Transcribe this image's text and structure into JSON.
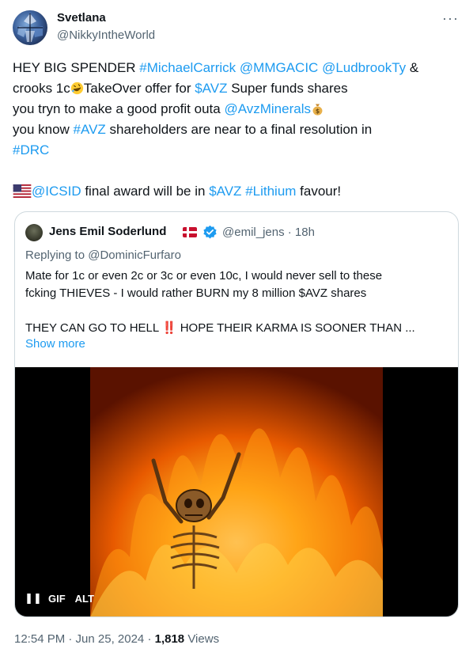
{
  "author": {
    "name": "Svetlana",
    "handle": "@NikkyIntheWorld",
    "avatar_icon": "stained-glass-avatar"
  },
  "more_label": "···",
  "tweet": {
    "l1_text1": "HEY BIG SPENDER ",
    "l1_link1": "#MichaelCarrick",
    "l1_link2": "@MMGACIC",
    "l1_link3": "@LudbrookTy",
    "l1_text2": " &",
    "l2_text1": "crooks 1c",
    "l2_emoji": "rolling-on-floor-laughing-emoji",
    "l2_text2": "TakeOver offer for ",
    "l2_link1": "$AVZ",
    "l2_text3": " Super funds shares",
    "l3_text1": "you tryn to make a good profit outa ",
    "l3_link1": "@AvzMinerals",
    "l3_emoji": "money-bag-emoji",
    "l4_text1": "you know ",
    "l4_link1": "#AVZ",
    "l4_text2": " shareholders are near to a final resolution in",
    "l5_link1": "#DRC",
    "l6_emoji": "us-flag-emoji",
    "l6_link1": "@ICSID",
    "l6_text1": " final award will be in ",
    "l6_link2": "$AVZ",
    "l6_link3": "#Lithium",
    "l6_text2": " favour!"
  },
  "quote": {
    "name": "Jens Emil Soderlund",
    "flag_icon": "denmark-flag-icon",
    "verified_icon": "verified-badge-icon",
    "handle_time": "@emil_jens · 18h",
    "replying_to": "Replying to @DominicFurfaro",
    "line1": "Mate for 1c or even 2c or 3c or even 10c, I would never sell to these",
    "line2": "fcking THIEVES - I would rather BURN my 8 million $AVZ shares",
    "line3_a": "THEY CAN GO TO HELL ",
    "line3_bang": "‼️",
    "line3_b": " HOPE THEIR KARMA IS SOONER THAN ...",
    "show_more": "Show more",
    "gif": {
      "pause_label": "❚❚",
      "gif_label": "GIF",
      "alt_label": "ALT",
      "image_icon": "skeleton-in-flames-gif"
    }
  },
  "meta": {
    "time": "12:54 PM · Jun 25, 2024 · ",
    "views_count": "1,818",
    "views_label": " Views"
  },
  "colors": {
    "link": "#1d9bf0",
    "text": "#0f1419",
    "muted": "#536471",
    "border": "#cfd9de"
  }
}
